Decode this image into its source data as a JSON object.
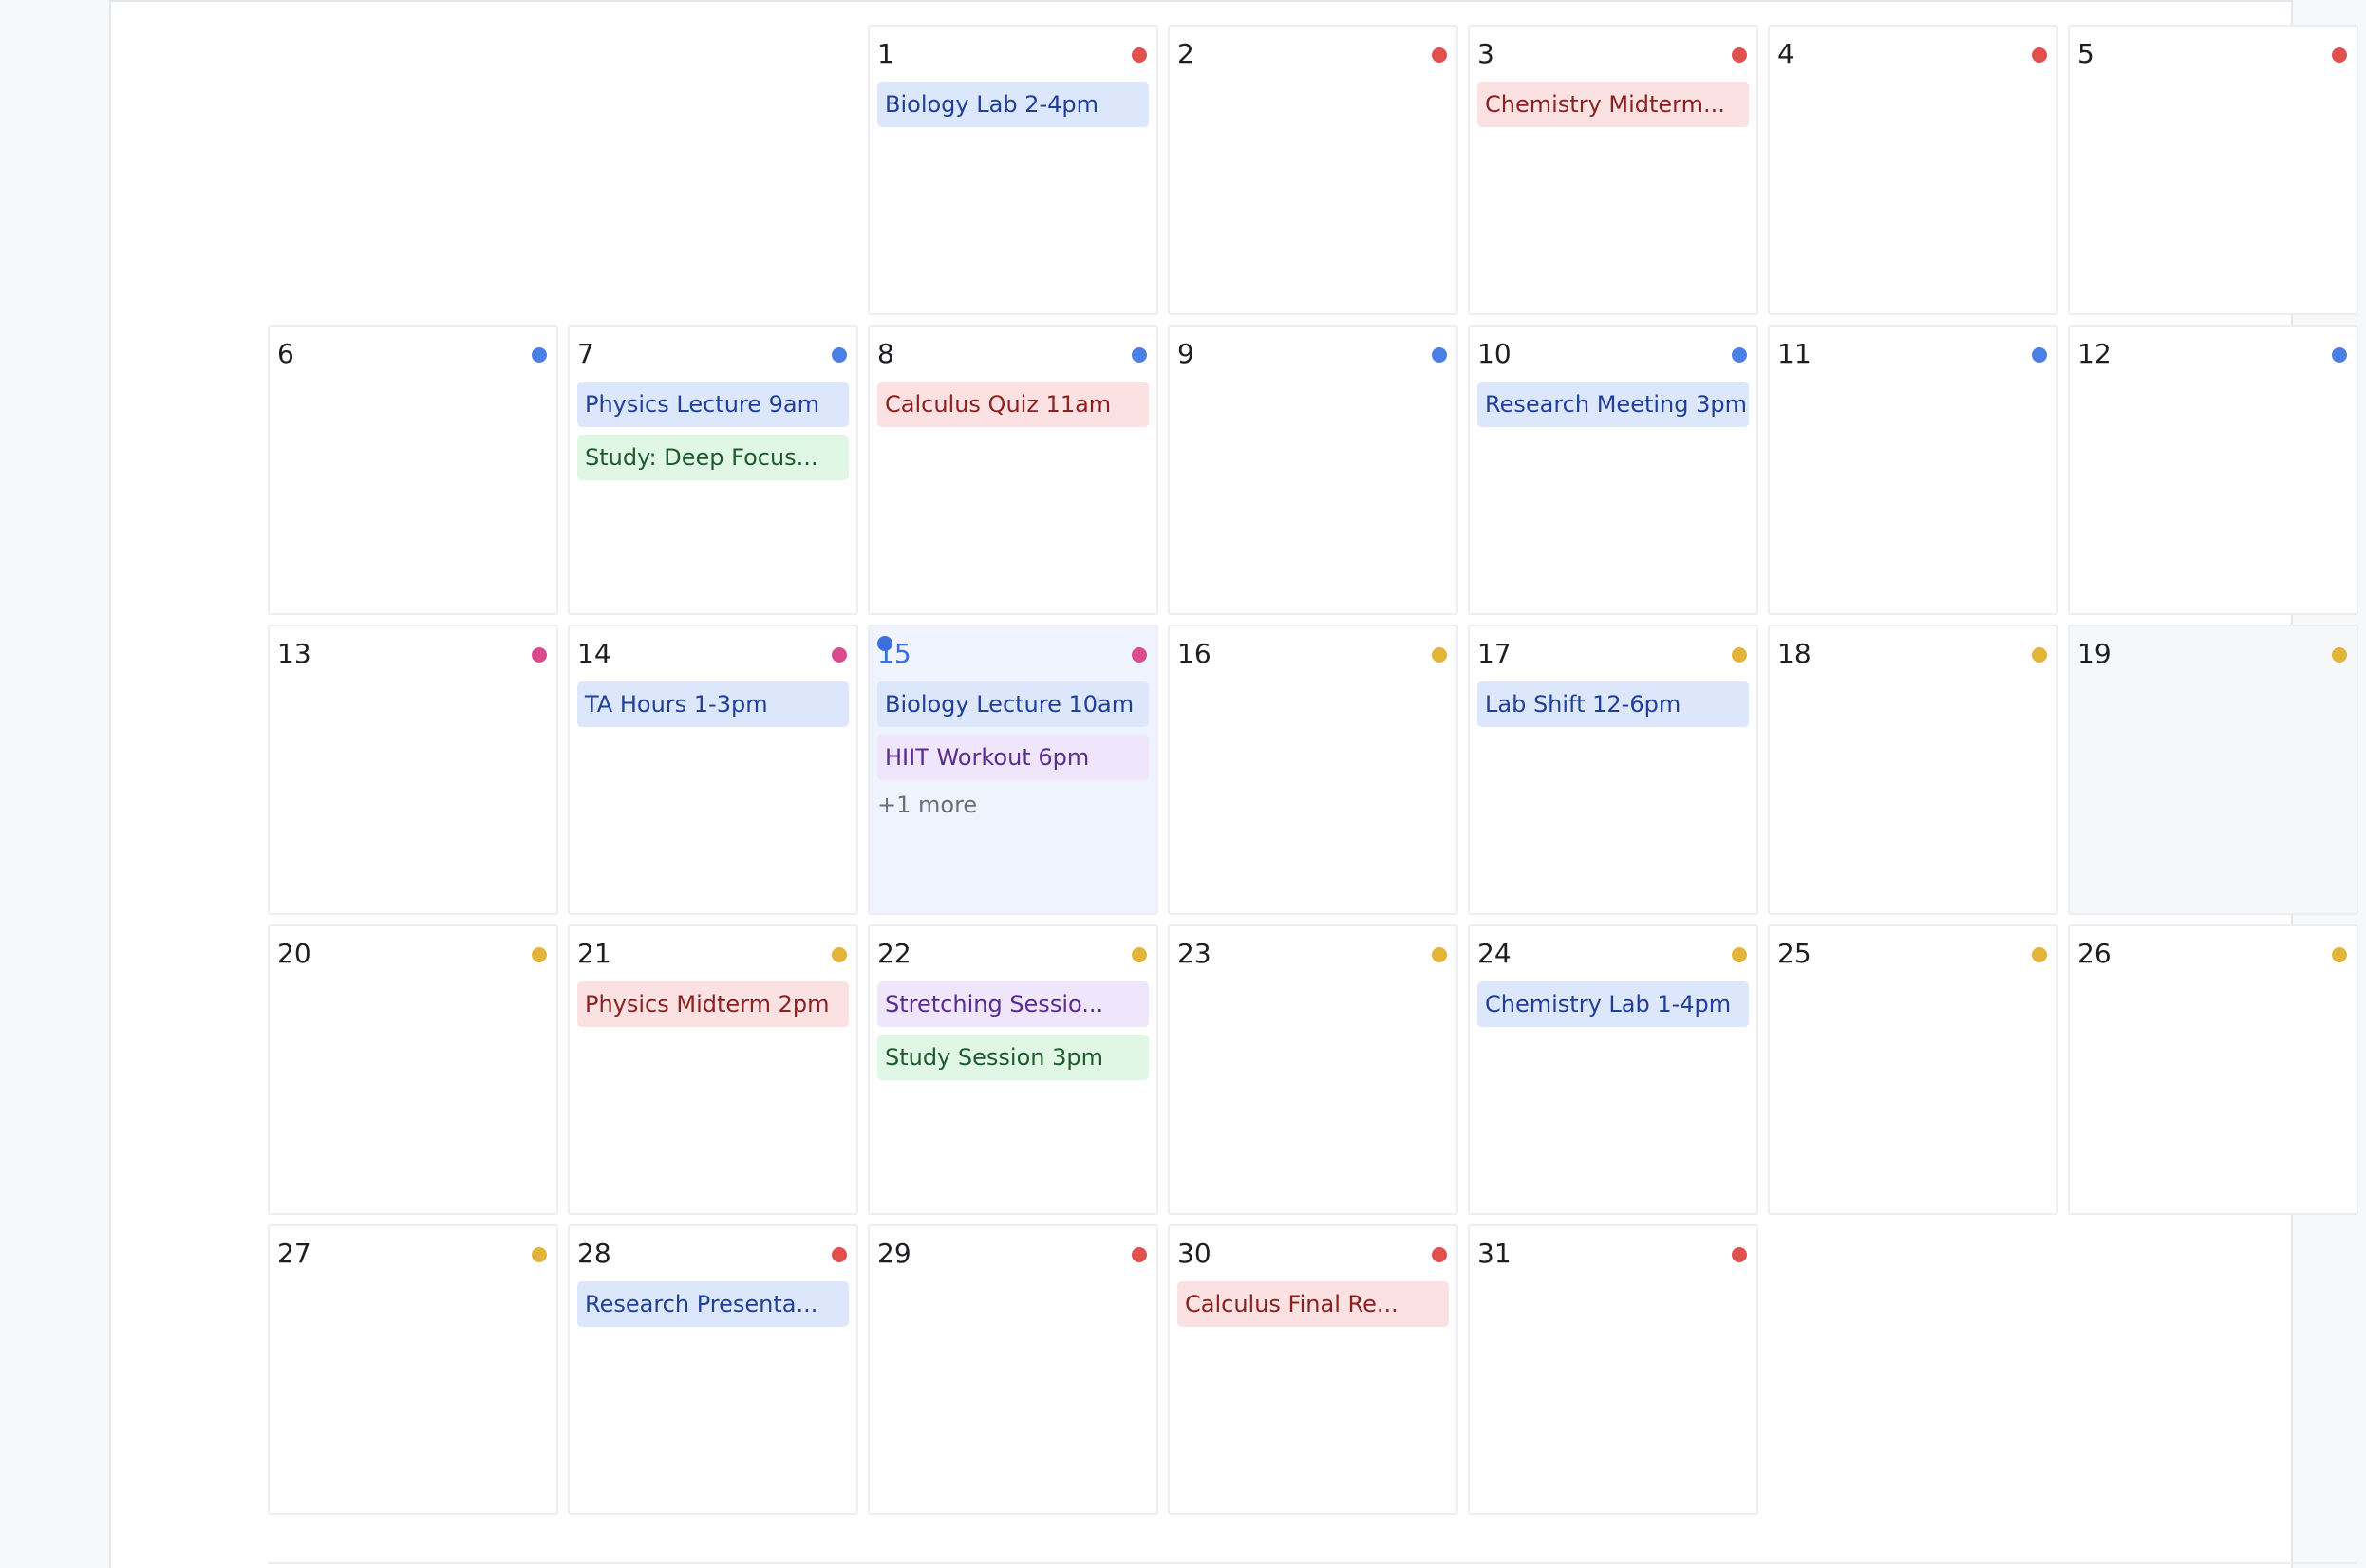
{
  "colors": {
    "red": "#e0504d",
    "blue": "#4a7fe5",
    "pink": "#d94b8e",
    "yellow": "#e3b43a",
    "today": "#3b6fde"
  },
  "calendar": {
    "leading_blank_days": 2,
    "days": [
      {
        "day": "1",
        "dot": "red",
        "events": [
          {
            "label": "Biology Lab 2-4pm",
            "kind": "blue"
          }
        ]
      },
      {
        "day": "2",
        "dot": "red",
        "events": []
      },
      {
        "day": "3",
        "dot": "red",
        "events": [
          {
            "label": "Chemistry Midterm...",
            "kind": "red"
          }
        ]
      },
      {
        "day": "4",
        "dot": "red",
        "events": []
      },
      {
        "day": "5",
        "dot": "red",
        "events": []
      },
      {
        "day": "6",
        "dot": "blue",
        "events": []
      },
      {
        "day": "7",
        "dot": "blue",
        "events": [
          {
            "label": "Physics Lecture 9am",
            "kind": "blue"
          },
          {
            "label": "Study: Deep Focus...",
            "kind": "green"
          }
        ]
      },
      {
        "day": "8",
        "dot": "blue",
        "events": [
          {
            "label": "Calculus Quiz 11am",
            "kind": "red"
          }
        ]
      },
      {
        "day": "9",
        "dot": "blue",
        "events": []
      },
      {
        "day": "10",
        "dot": "blue",
        "events": [
          {
            "label": "Research Meeting 3pm",
            "kind": "blue"
          }
        ]
      },
      {
        "day": "11",
        "dot": "blue",
        "events": []
      },
      {
        "day": "12",
        "dot": "blue",
        "events": []
      },
      {
        "day": "13",
        "dot": "pink",
        "events": []
      },
      {
        "day": "14",
        "dot": "pink",
        "events": [
          {
            "label": "TA Hours 1-3pm",
            "kind": "blue"
          }
        ]
      },
      {
        "day": "15",
        "dot": "pink",
        "today": true,
        "events": [
          {
            "label": "Biology Lecture 10am",
            "kind": "blue"
          },
          {
            "label": "HIIT Workout 6pm",
            "kind": "purple"
          }
        ],
        "more": "+1 more"
      },
      {
        "day": "16",
        "dot": "yellow",
        "events": []
      },
      {
        "day": "17",
        "dot": "yellow",
        "events": [
          {
            "label": "Lab Shift 12-6pm",
            "kind": "blue"
          }
        ]
      },
      {
        "day": "18",
        "dot": "yellow",
        "events": []
      },
      {
        "day": "19",
        "dot": "yellow",
        "shaded": true,
        "events": []
      },
      {
        "day": "20",
        "dot": "yellow",
        "events": []
      },
      {
        "day": "21",
        "dot": "yellow",
        "events": [
          {
            "label": "Physics Midterm 2pm",
            "kind": "red"
          }
        ]
      },
      {
        "day": "22",
        "dot": "yellow",
        "events": [
          {
            "label": "Stretching Sessio...",
            "kind": "purple"
          },
          {
            "label": "Study Session 3pm",
            "kind": "green"
          }
        ]
      },
      {
        "day": "23",
        "dot": "yellow",
        "events": []
      },
      {
        "day": "24",
        "dot": "yellow",
        "events": [
          {
            "label": "Chemistry Lab 1-4pm",
            "kind": "blue"
          }
        ]
      },
      {
        "day": "25",
        "dot": "yellow",
        "events": []
      },
      {
        "day": "26",
        "dot": "yellow",
        "events": []
      },
      {
        "day": "27",
        "dot": "yellow",
        "events": []
      },
      {
        "day": "28",
        "dot": "red",
        "events": [
          {
            "label": "Research Presenta...",
            "kind": "blue"
          }
        ]
      },
      {
        "day": "29",
        "dot": "red",
        "events": []
      },
      {
        "day": "30",
        "dot": "red",
        "events": [
          {
            "label": "Calculus Final Re...",
            "kind": "red"
          }
        ]
      },
      {
        "day": "31",
        "dot": "red",
        "events": []
      }
    ]
  }
}
